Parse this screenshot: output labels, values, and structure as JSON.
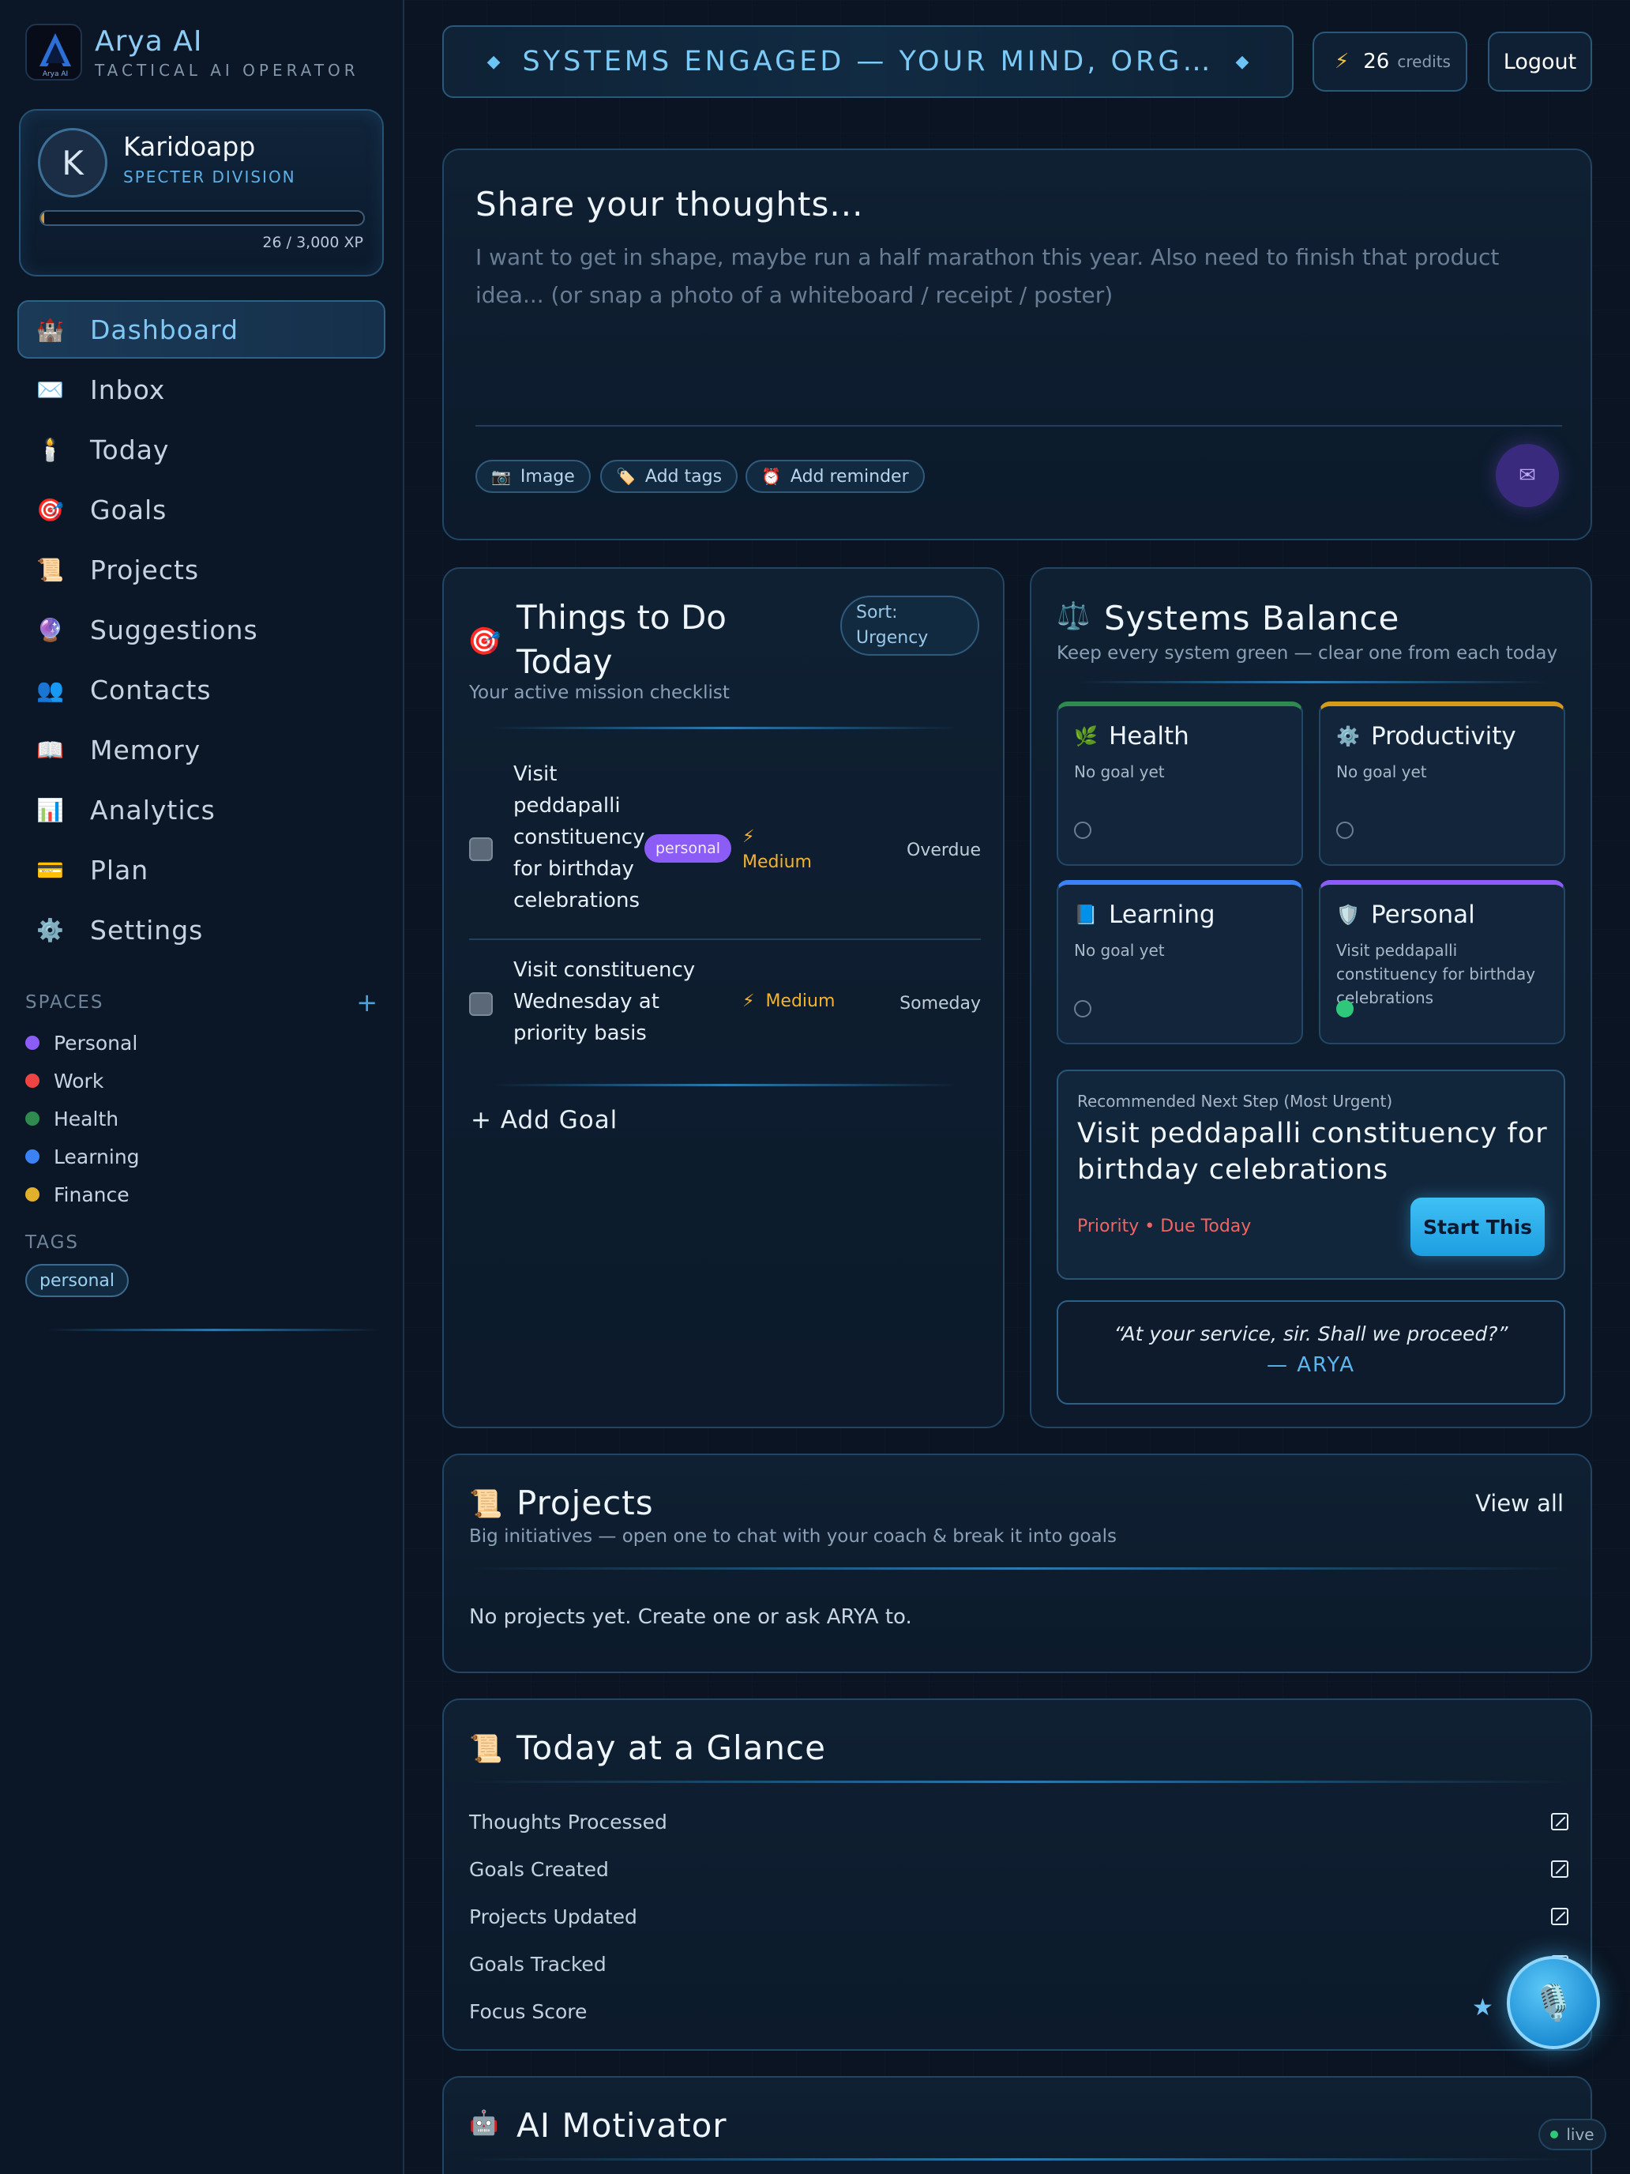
{
  "brand": {
    "name": "Arya AI",
    "tagline": "TACTICAL AI OPERATOR",
    "logo_text": "Arya AI"
  },
  "profile": {
    "initial": "K",
    "name": "Karidoapp",
    "division": "SPECTER DIVISION",
    "xp_text": "26 / 3,000 XP",
    "xp_fraction": 0.0087
  },
  "nav": [
    {
      "icon": "castle-icon",
      "glyph": "🏰",
      "label": "Dashboard",
      "active": true
    },
    {
      "icon": "envelope-icon",
      "glyph": "✉️",
      "label": "Inbox"
    },
    {
      "icon": "candle-icon",
      "glyph": "🕯️",
      "label": "Today"
    },
    {
      "icon": "target-icon",
      "glyph": "🎯",
      "label": "Goals"
    },
    {
      "icon": "scroll-icon",
      "glyph": "📜",
      "label": "Projects"
    },
    {
      "icon": "crystal-ball-icon",
      "glyph": "🔮",
      "label": "Suggestions"
    },
    {
      "icon": "people-icon",
      "glyph": "👥",
      "label": "Contacts"
    },
    {
      "icon": "book-icon",
      "glyph": "📖",
      "label": "Memory"
    },
    {
      "icon": "bar-chart-icon",
      "glyph": "📊",
      "label": "Analytics"
    },
    {
      "icon": "credit-card-icon",
      "glyph": "💳",
      "label": "Plan"
    },
    {
      "icon": "gear-icon",
      "glyph": "⚙️",
      "label": "Settings"
    }
  ],
  "spaces": {
    "heading": "SPACES",
    "items": [
      {
        "label": "Personal",
        "color": "#8b5cf6"
      },
      {
        "label": "Work",
        "color": "#ef4444"
      },
      {
        "label": "Health",
        "color": "#2f8a4f"
      },
      {
        "label": "Learning",
        "color": "#3b82f6"
      },
      {
        "label": "Finance",
        "color": "#e1b12c"
      }
    ]
  },
  "tags": {
    "heading": "TAGS",
    "items": [
      "personal"
    ]
  },
  "banner": {
    "text": "SYSTEMS ENGAGED — YOUR MIND, ORG…",
    "diamond": "◆"
  },
  "credits": {
    "icon": "⚡",
    "value": "26",
    "label": "credits"
  },
  "logout_label": "Logout",
  "compose": {
    "title": "Share your thoughts...",
    "placeholder": "I want to get in shape, maybe run a half marathon this year. Also need to finish that product idea... (or snap a photo of a whiteboard / receipt / poster)",
    "chips": [
      {
        "icon": "camera-icon",
        "glyph": "📷",
        "label": "Image"
      },
      {
        "icon": "tag-icon",
        "glyph": "🏷️",
        "label": "Add tags"
      },
      {
        "icon": "alarm-clock-icon",
        "glyph": "⏰",
        "label": "Add reminder"
      }
    ],
    "send_glyph": "✉"
  },
  "todo": {
    "icon": "🎯",
    "title": "Things to Do Today",
    "sort": "Sort: Urgency",
    "subtitle": "Your active mission checklist",
    "tasks": [
      {
        "text": "Visit peddapalli constituency for birthday celebrations",
        "badge": "personal",
        "priority_icon": "⚡",
        "priority": "Medium",
        "when": "Overdue"
      },
      {
        "text": "Visit constituency Wednesday at priority basis",
        "badge": "",
        "priority_icon": "⚡",
        "priority": "Medium",
        "when": "Someday"
      }
    ],
    "add_goal": "+ Add Goal"
  },
  "balance": {
    "icon": "⚖️",
    "title": "Systems Balance",
    "subtitle": "Keep every system green — clear one from each today",
    "systems": [
      {
        "name": "Health",
        "glyph": "🌿",
        "icon": "leaf-icon",
        "goal": "No goal yet",
        "color": "#2f8a4f",
        "done": false
      },
      {
        "name": "Productivity",
        "glyph": "⚙️",
        "icon": "gear-icon",
        "goal": "No goal yet",
        "color": "#d39a1c",
        "done": false
      },
      {
        "name": "Learning",
        "glyph": "📘",
        "icon": "book-icon",
        "goal": "No goal yet",
        "color": "#3b82f6",
        "done": false
      },
      {
        "name": "Personal",
        "glyph": "🛡️",
        "icon": "shield-icon",
        "goal": "Visit peddapalli constituency for birthday celebrations",
        "color": "#8b5cf6",
        "done": true
      }
    ],
    "next_step": {
      "caption": "Recommended Next Step (Most Urgent)",
      "title": "Visit peddapalli constituency for birthday celebrations",
      "meta": "Priority • Due Today",
      "button": "Start This"
    },
    "quote": {
      "text": "“At your service, sir. Shall we proceed?”",
      "by": "— ARYA"
    }
  },
  "projects": {
    "icon": "📜",
    "title": "Projects",
    "view_all": "View all",
    "subtitle": "Big initiatives — open one to chat with your coach & break it into goals",
    "empty": "No projects yet. Create one or ask ARYA to."
  },
  "glance": {
    "icon": "📜",
    "title": "Today at a Glance",
    "rows": [
      "Thoughts Processed",
      "Goals Created",
      "Projects Updated",
      "Goals Tracked",
      "Focus Score"
    ]
  },
  "motivator": {
    "icon": "🤖",
    "title": "AI Motivator",
    "live": "live"
  },
  "fab": {
    "glyph": "🎙️"
  }
}
